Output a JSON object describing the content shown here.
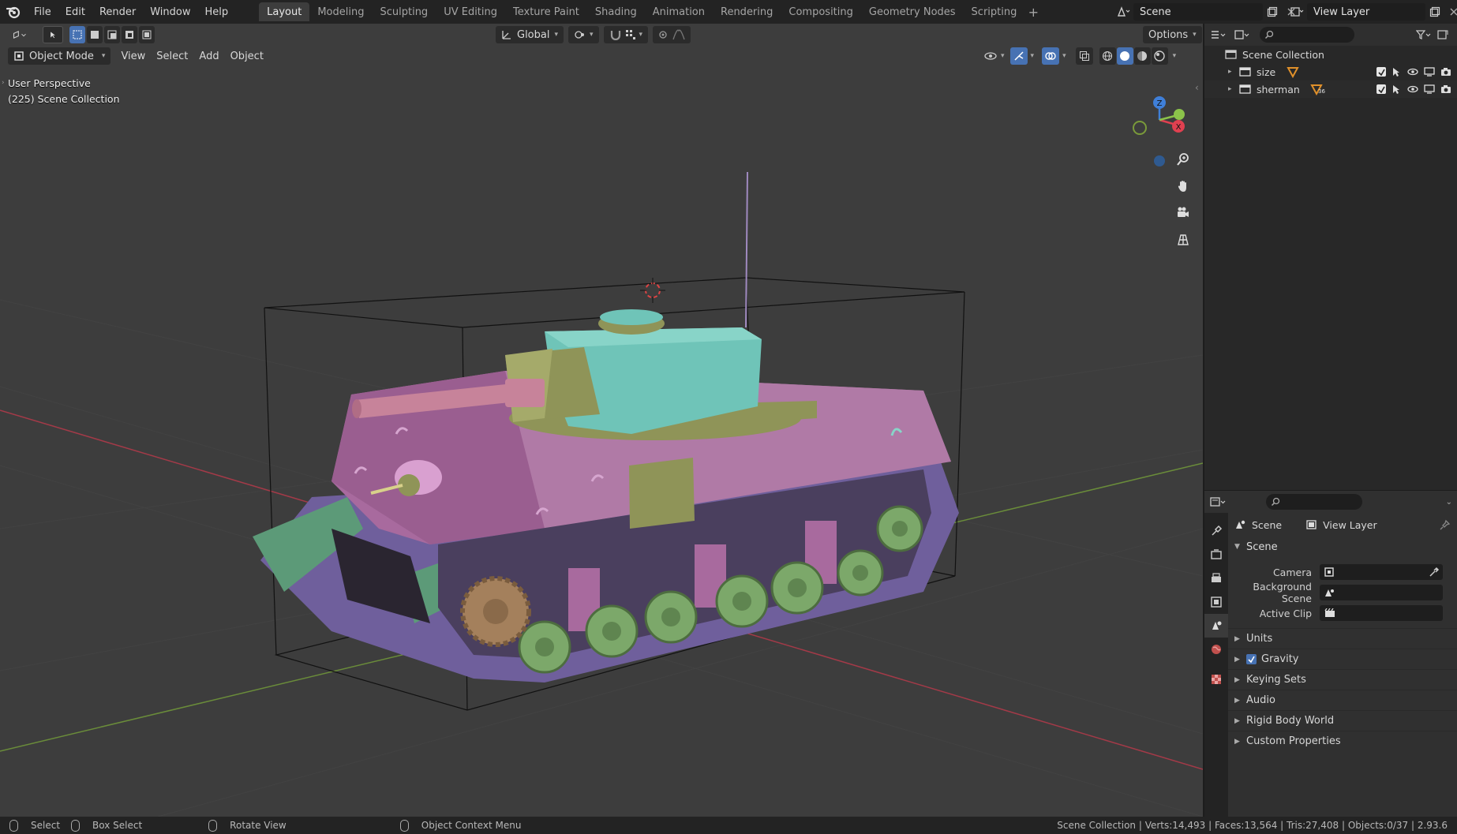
{
  "menu": [
    "File",
    "Edit",
    "Render",
    "Window",
    "Help"
  ],
  "workspaces": [
    {
      "label": "Layout",
      "active": true
    },
    {
      "label": "Modeling",
      "active": false
    },
    {
      "label": "Sculpting",
      "active": false
    },
    {
      "label": "UV Editing",
      "active": false
    },
    {
      "label": "Texture Paint",
      "active": false
    },
    {
      "label": "Shading",
      "active": false
    },
    {
      "label": "Animation",
      "active": false
    },
    {
      "label": "Rendering",
      "active": false
    },
    {
      "label": "Compositing",
      "active": false
    },
    {
      "label": "Geometry Nodes",
      "active": false
    },
    {
      "label": "Scripting",
      "active": false
    }
  ],
  "workspace_add": "+",
  "scene_name": "Scene",
  "view_layer_name": "View Layer",
  "viewport": {
    "transform_orientation": "Global",
    "options_label": "Options",
    "mode": "Object Mode",
    "header_menus": [
      "View",
      "Select",
      "Add",
      "Object"
    ],
    "info_line1": "User Perspective",
    "info_line2": "(225) Scene Collection",
    "gizmo_axes": {
      "z": "Z",
      "x": "X"
    }
  },
  "outliner": {
    "root": "Scene Collection",
    "items": [
      {
        "name": "size",
        "icon": "mesh-data-icon",
        "alt": false
      },
      {
        "name": "sherman",
        "icon": "mesh-data-icon",
        "badge": "36",
        "alt": true
      }
    ]
  },
  "properties": {
    "breadcrumb_scene": "Scene",
    "breadcrumb_view_layer": "View Layer",
    "panel_title": "Scene",
    "fields": [
      {
        "label": "Camera",
        "icon": "camera-icon"
      },
      {
        "label": "Background Scene",
        "icon": "scene-icon"
      },
      {
        "label": "Active Clip",
        "icon": "clip-icon"
      }
    ],
    "subpanels": [
      "Units",
      "Gravity",
      "Keying Sets",
      "Audio",
      "Rigid Body World",
      "Custom Properties"
    ]
  },
  "statusbar": {
    "select": "Select",
    "box_select": "Box Select",
    "rotate_view": "Rotate View",
    "context_menu": "Object Context Menu",
    "stats": "Scene Collection | Verts:14,493 | Faces:13,564 | Tris:27,408 | Objects:0/37 | 2.93.6"
  },
  "colors": {
    "viewport_bg": "#3d3d3d",
    "hull": "#a86a9e",
    "turret": "#6fc4b8",
    "olive": "#8f9458",
    "wheels": "#7ca86a",
    "tracks": "#7a6aa8",
    "fender": "#5c9a78",
    "accent": "#4772b3",
    "x_axis": "#e04050",
    "y_axis": "#8bc34a",
    "z_axis": "#3f7fd8"
  }
}
